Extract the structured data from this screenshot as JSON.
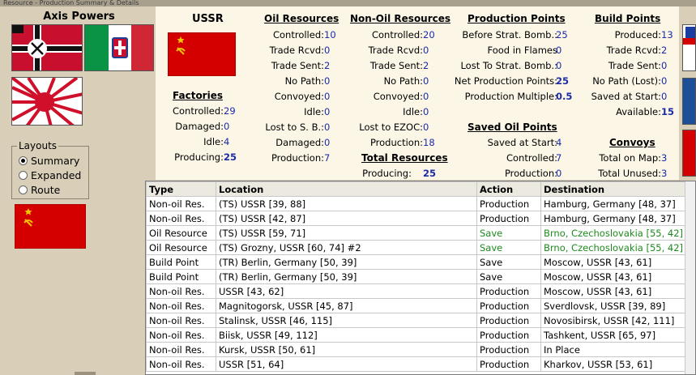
{
  "window": {
    "title": "Resource - Production Summary & Details"
  },
  "sidebar": {
    "title": "Axis Powers",
    "layouts_label": "Layouts",
    "layouts": [
      {
        "label": "Summary",
        "selected": true
      },
      {
        "label": "Expanded",
        "selected": false
      },
      {
        "label": "Route",
        "selected": false
      }
    ]
  },
  "country": {
    "name": "USSR"
  },
  "factories": {
    "header": "Factories",
    "rows": [
      {
        "label": "Controlled:",
        "value": "29"
      },
      {
        "label": "Damaged:",
        "value": "0"
      },
      {
        "label": "Idle:",
        "value": "4"
      },
      {
        "label": "Producing:",
        "value": "25"
      }
    ]
  },
  "oil": {
    "header": "Oil Resources",
    "rows": [
      {
        "label": "Controlled:",
        "value": "10"
      },
      {
        "label": "Trade Rcvd:",
        "value": "0"
      },
      {
        "label": "Trade Sent:",
        "value": "2"
      },
      {
        "label": "No Path:",
        "value": "0"
      },
      {
        "label": "Convoyed:",
        "value": "0"
      },
      {
        "label": "Idle:",
        "value": "0"
      },
      {
        "label": "Lost to S. B.:",
        "value": "0"
      },
      {
        "label": "Damaged:",
        "value": "0"
      },
      {
        "label": "Production:",
        "value": "7"
      }
    ]
  },
  "nonoil": {
    "header": "Non-Oil Resources",
    "rows": [
      {
        "label": "Controlled:",
        "value": "20"
      },
      {
        "label": "Trade Rcvd:",
        "value": "0"
      },
      {
        "label": "Trade Sent:",
        "value": "2"
      },
      {
        "label": "No Path:",
        "value": "0"
      },
      {
        "label": "Convoyed:",
        "value": "0"
      },
      {
        "label": "Idle:",
        "value": "0"
      },
      {
        "label": "Lost to EZOC:",
        "value": "0"
      },
      {
        "label": "Production:",
        "value": "18"
      }
    ],
    "total_header": "Total Resources",
    "total_row": {
      "label": "Producing:",
      "value": "25"
    }
  },
  "production_points": {
    "header": "Production Points",
    "rows": [
      {
        "label": "Before Strat. Bomb.:",
        "value": "25"
      },
      {
        "label": "Food in Flames",
        "value": "0"
      },
      {
        "label": "Lost To Strat. Bomb.:",
        "value": "0"
      },
      {
        "label": "Net Production Points:",
        "value": "25"
      },
      {
        "label": "Production Multiple:",
        "value": "0.5"
      }
    ],
    "saved_header": "Saved Oil Points",
    "saved_rows": [
      {
        "label": "Saved at Start:",
        "value": "4"
      },
      {
        "label": "Controlled:",
        "value": "7"
      },
      {
        "label": "Production:",
        "value": "0"
      }
    ]
  },
  "build_points": {
    "header": "Build Points",
    "rows": [
      {
        "label": "Produced:",
        "value": "13"
      },
      {
        "label": "Trade Rcvd:",
        "value": "2"
      },
      {
        "label": "Trade Sent:",
        "value": "0"
      },
      {
        "label": "No Path (Lost):",
        "value": "0"
      },
      {
        "label": "Saved at Start:",
        "value": "0"
      },
      {
        "label": "Available:",
        "value": "15"
      }
    ],
    "convoys_header": "Convoys",
    "convoys_rows": [
      {
        "label": "Total on Map:",
        "value": "3"
      },
      {
        "label": "Total Unused:",
        "value": "3"
      }
    ]
  },
  "details": {
    "columns": [
      "Type",
      "Location",
      "Action",
      "Destination"
    ],
    "rows": [
      [
        "Non-oil Res.",
        "(TS) USSR [39, 88]",
        "Production",
        "Hamburg, Germany [48, 37]"
      ],
      [
        "Non-oil Res.",
        "(TS) USSR [42, 87]",
        "Production",
        "Hamburg, Germany [48, 37]"
      ],
      [
        "Oil Resource",
        "(TS) USSR [59, 71]",
        "Save",
        "Brno, Czechoslovakia [55, 42]"
      ],
      [
        "Oil Resource",
        "(TS) Grozny, USSR [60, 74] #2",
        "Save",
        "Brno, Czechoslovakia [55, 42]"
      ],
      [
        "Build Point",
        "(TR) Berlin, Germany [50, 39]",
        "Save",
        "Moscow, USSR [43, 61]"
      ],
      [
        "Build Point",
        "(TR) Berlin, Germany [50, 39]",
        "Save",
        "Moscow, USSR [43, 61]"
      ],
      [
        "Non-oil Res.",
        "USSR [43, 62]",
        "Production",
        "Moscow, USSR [43, 61]"
      ],
      [
        "Non-oil Res.",
        "Magnitogorsk, USSR [45, 87]",
        "Production",
        "Sverdlovsk, USSR [39, 89]"
      ],
      [
        "Non-oil Res.",
        "Stalinsk, USSR [46, 115]",
        "Production",
        "Novosibirsk, USSR [42, 111]"
      ],
      [
        "Non-oil Res.",
        "Biisk, USSR [49, 112]",
        "Production",
        "Tashkent, USSR [65, 97]"
      ],
      [
        "Non-oil Res.",
        "Kursk, USSR [50, 61]",
        "Production",
        "In Place"
      ],
      [
        "Non-oil Res.",
        "USSR [51, 64]",
        "Production",
        "Kharkov, USSR [53, 61]"
      ]
    ],
    "green_rows": [
      2,
      3
    ],
    "colors": {
      "save_highlight": "#1d8a1d",
      "value_blue": "#1a2aa8",
      "ussr_red": "#d40000"
    }
  }
}
